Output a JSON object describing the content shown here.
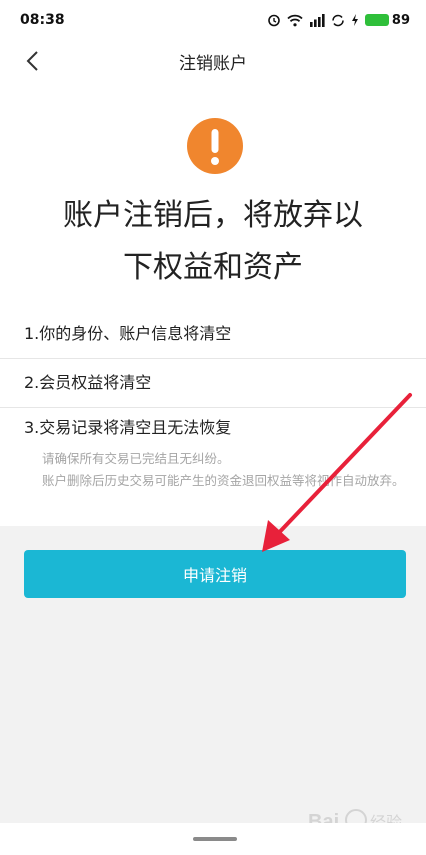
{
  "status_bar": {
    "time": "08:38",
    "icons": [
      "alarm-icon",
      "wifi-icon",
      "signal-icon",
      "sync-icon",
      "charging-icon"
    ],
    "battery_level": "89",
    "battery_color": "#2fbf3a"
  },
  "nav": {
    "back_icon": "chevron-left-icon",
    "title": "注销账户"
  },
  "warning": {
    "icon": "exclamation-icon",
    "color": "#f0862e",
    "headline_line1": "账户注销后，将放弃以",
    "headline_line2": "下权益和资产"
  },
  "items": [
    {
      "title": "1.你的身份、账户信息将清空"
    },
    {
      "title": "2.会员权益将清空"
    },
    {
      "title": "3.交易记录将清空且无法恢复",
      "notes": [
        "请确保所有交易已完结且无纠纷。",
        "账户删除后历史交易可能产生的资金退回权益等将视作自动放弃。"
      ]
    }
  ],
  "apply_button": {
    "label": "申请注销",
    "color": "#1bb7d4"
  },
  "annotation": {
    "arrow_color": "#e8213a"
  },
  "watermark": {
    "text": "Bai百 经验"
  }
}
